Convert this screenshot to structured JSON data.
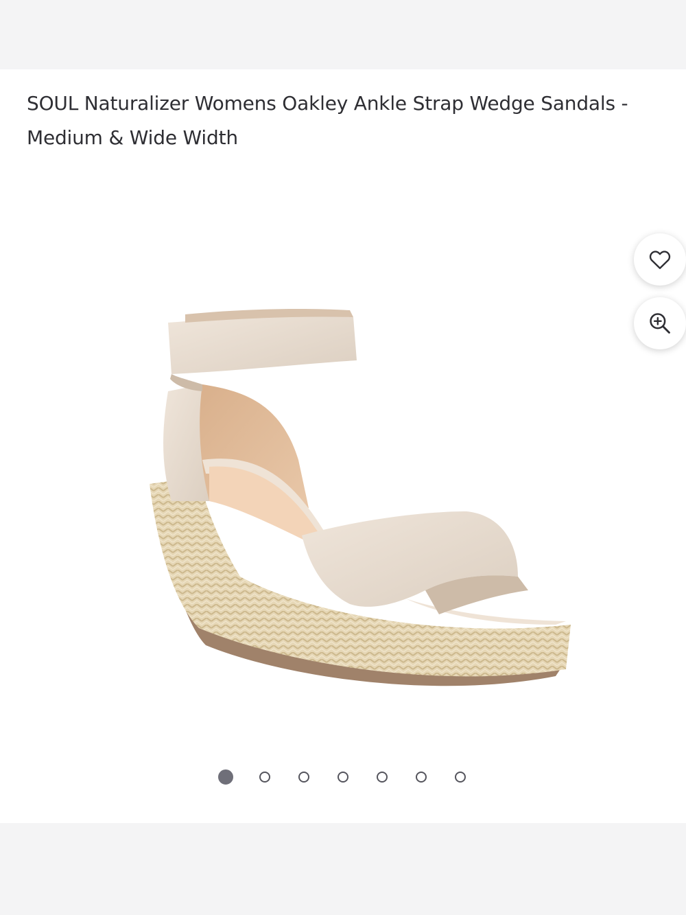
{
  "product": {
    "title": "SOUL Naturalizer Womens Oakley Ankle Strap Wedge Sandals - Medium & Wide Width",
    "image_alt": "SOUL Naturalizer Womens Oakley Ankle Strap Wedge Sandals"
  },
  "actions": {
    "wishlist_icon": "heart-icon",
    "zoom_icon": "zoom-in-icon"
  },
  "carousel": {
    "total_images": 7,
    "active_index": 0,
    "active_color": "#6f6f79",
    "inactive_border_color": "#54545c"
  }
}
